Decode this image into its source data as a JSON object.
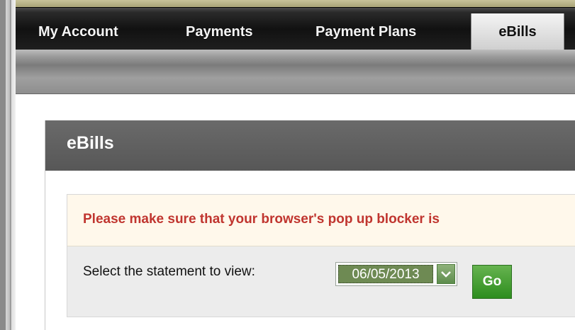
{
  "nav": {
    "items": [
      {
        "label": "My Account"
      },
      {
        "label": "Payments"
      },
      {
        "label": "Payment Plans"
      },
      {
        "label": "eBills",
        "active": true
      }
    ]
  },
  "panel": {
    "title": "eBills"
  },
  "notice": {
    "text": "Please make sure that your browser's pop up blocker is"
  },
  "statement": {
    "label": "Select the statement to view:",
    "selected": "06/05/2013",
    "go_label": "Go"
  },
  "colors": {
    "go_button": "#3b9a2a",
    "notice_text": "#c0352f",
    "header_bg": "#5f5f5f"
  },
  "icons": {
    "select_arrow": "chevron-down-icon"
  }
}
